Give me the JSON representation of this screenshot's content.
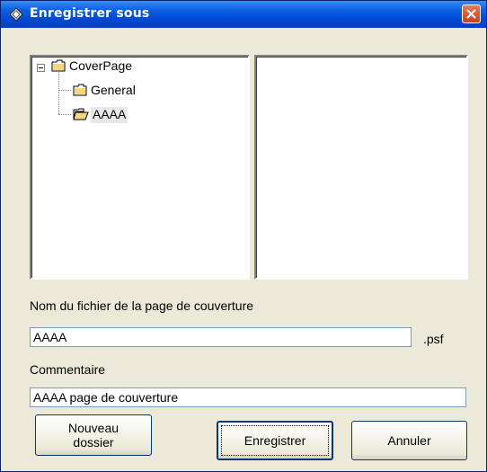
{
  "window": {
    "title": "Enregistrer sous"
  },
  "tree": {
    "root": {
      "label": "CoverPage",
      "expander": "minus"
    },
    "children": [
      {
        "label": "General",
        "icon": "folder-closed-icon"
      },
      {
        "label": "AAAA",
        "icon": "folder-open-icon",
        "selected": true
      }
    ]
  },
  "filename": {
    "label": "Nom du fichier de la page de couverture",
    "value": "AAAA",
    "extension": ".psf"
  },
  "comment": {
    "label": "Commentaire",
    "value": "AAAA page de couverture"
  },
  "buttons": {
    "new_folder": "Nouveau dossier",
    "save": "Enregistrer",
    "cancel": "Annuler"
  },
  "colors": {
    "titlebar": "#0347d4",
    "dialog_bg": "#ece9d8",
    "close_button": "#d9582f",
    "folder": "#f7d77a"
  }
}
